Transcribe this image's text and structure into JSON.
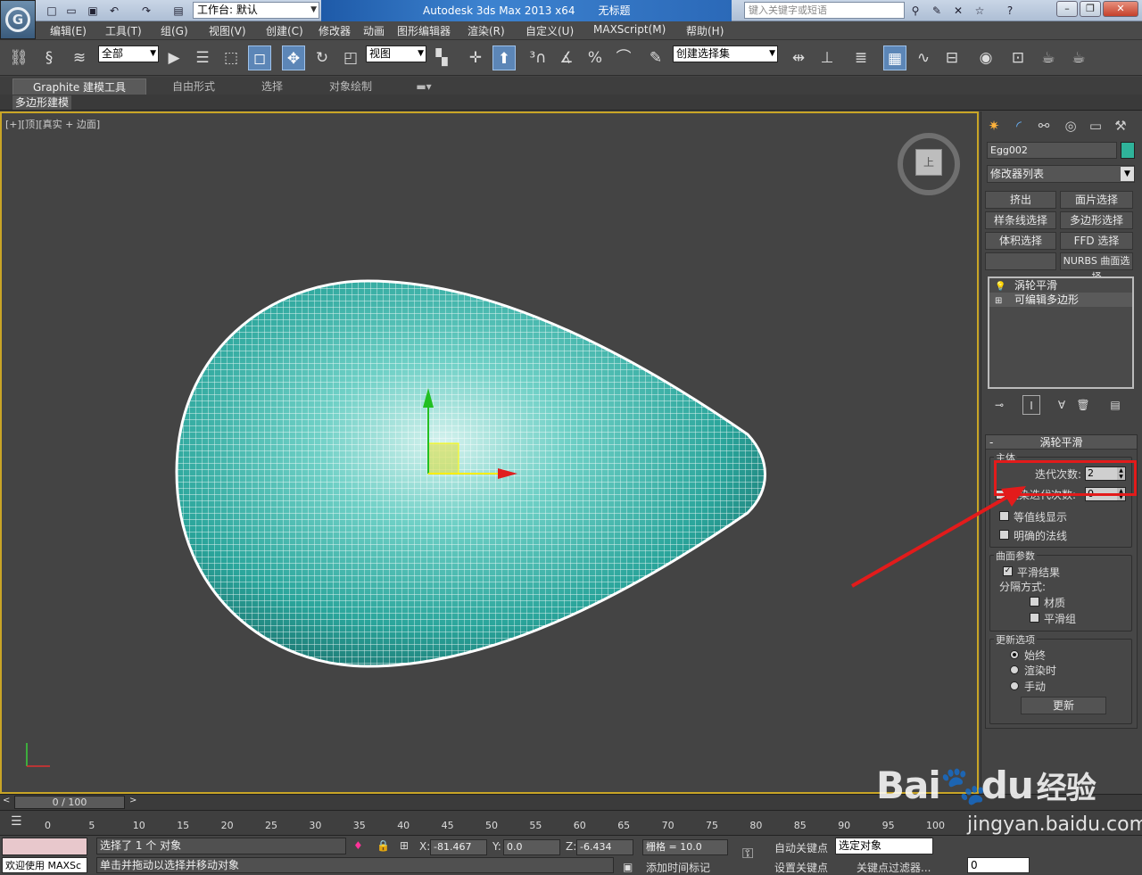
{
  "app": {
    "workspace_label": "工作台: 默认",
    "title_app": "Autodesk 3ds Max  2013 x64",
    "title_doc": "无标题",
    "search_placeholder": "键入关键字或短语"
  },
  "menu": [
    "编辑(E)",
    "工具(T)",
    "组(G)",
    "视图(V)",
    "创建(C)",
    "修改器",
    "动画",
    "图形编辑器",
    "渲染(R)",
    "自定义(U)",
    "MAXScript(M)",
    "帮助(H)"
  ],
  "toolbar": {
    "selection_filter": "全部",
    "ref_coord": "视图",
    "named_selection": "创建选择集"
  },
  "ribbon": {
    "tabs": [
      "Graphite 建模工具",
      "自由形式",
      "选择",
      "对象绘制"
    ],
    "panel": "多边形建模"
  },
  "viewport": {
    "label": "[+][顶][真实 + 边面]",
    "viewcube_face": "上"
  },
  "command_panel": {
    "object_name": "Egg002",
    "object_color": "#2fb39a",
    "modifier_list": "修改器列表",
    "modifier_buttons": [
      "挤出",
      "面片选择",
      "样条线选择",
      "多边形选择",
      "体积选择",
      "FFD 选择",
      "",
      "NURBS 曲面选择"
    ],
    "stack": [
      "涡轮平滑",
      "可编辑多边形"
    ],
    "rollout": {
      "title": "涡轮平滑",
      "main_group": "主体",
      "iterations_label": "迭代次数:",
      "iterations_value": "2",
      "render_iters_label": "渲染迭代次数:",
      "render_iters_value": "0",
      "isoline": "等值线显示",
      "explicit_normals": "明确的法线",
      "surface_group": "曲面参数",
      "smooth_result": "平滑结果",
      "separate_by": "分隔方式:",
      "materials": "材质",
      "smoothing_groups": "平滑组",
      "update_group": "更新选项",
      "always": "始终",
      "when_rendering": "渲染时",
      "manually": "手动",
      "update_button": "更新"
    }
  },
  "timeline": {
    "frame": "0 / 100",
    "ticks": [
      "0",
      "5",
      "10",
      "15",
      "20",
      "25",
      "30",
      "35",
      "40",
      "45",
      "50",
      "55",
      "60",
      "65",
      "70",
      "75",
      "80",
      "85",
      "90",
      "95",
      "100"
    ]
  },
  "status": {
    "maxscript": "欢迎使用 MAXSc",
    "selected": "选择了 1 个 对象",
    "prompt": "单击并拖动以选择并移动对象",
    "x_label": "X:",
    "x_value": "-81.467",
    "y_label": "Y:",
    "y_value": "0.0",
    "z_label": "Z:",
    "z_value": "-6.434",
    "grid": "栅格 = 10.0",
    "add_time_tag": "添加时间标记",
    "auto_key": "自动关键点",
    "set_key": "设置关键点",
    "selected_obj": "选定对象",
    "key_filters": "关键点过滤器...",
    "frame_field": "0"
  },
  "watermark": {
    "brand": "Bai",
    "brand2": "du",
    "suffix": "经验",
    "url": "jingyan.baidu.com"
  }
}
